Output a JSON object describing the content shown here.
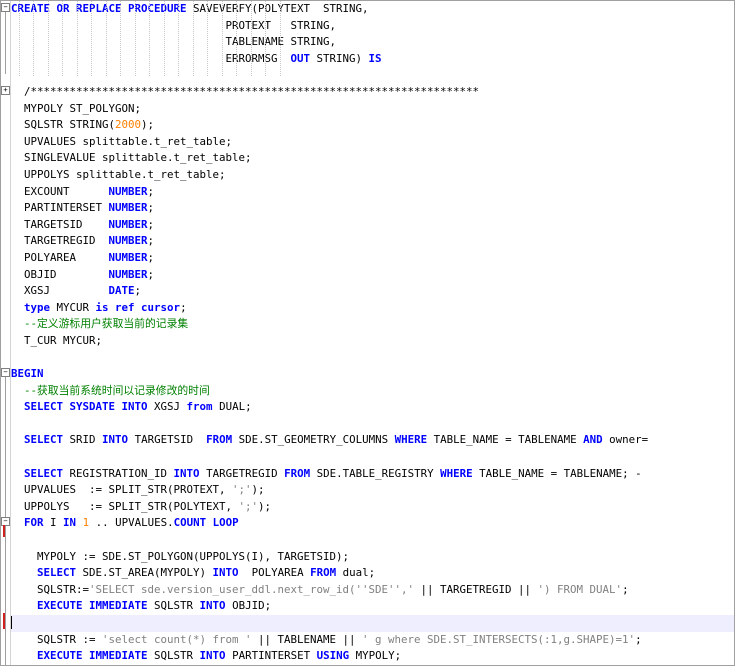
{
  "editor": {
    "language": "PL/SQL",
    "lines": [
      [
        [
          "CREATE OR REPLACE PROCEDURE",
          "kwb"
        ],
        [
          " SAVEVERFY(POLYTEXT  STRING,",
          ""
        ]
      ],
      [
        [
          "                                 PROTEXT   STRING,",
          ""
        ]
      ],
      [
        [
          "                                 TABLENAME STRING,",
          ""
        ]
      ],
      [
        [
          "                                 ERRORMSG  ",
          ""
        ],
        [
          "OUT",
          "kwb"
        ],
        [
          " STRING) ",
          ""
        ],
        [
          "IS",
          "kwb"
        ]
      ],
      [
        [
          "",
          ""
        ]
      ],
      [
        [
          "  /*********************************************************************",
          ""
        ]
      ],
      [
        [
          "  MYPOLY ST_POLYGON;",
          ""
        ]
      ],
      [
        [
          "  SQLSTR STRING(",
          ""
        ],
        [
          "2000",
          "num"
        ],
        [
          ");",
          ""
        ]
      ],
      [
        [
          "  UPVALUES splittable.t_ret_table;",
          ""
        ]
      ],
      [
        [
          "  SINGLEVALUE splittable.t_ret_table;",
          ""
        ]
      ],
      [
        [
          "  UPPOLYS splittable.t_ret_table;",
          ""
        ]
      ],
      [
        [
          "  EXCOUNT      ",
          ""
        ],
        [
          "NUMBER",
          "kwb"
        ],
        [
          ";",
          ""
        ]
      ],
      [
        [
          "  PARTINTERSET ",
          ""
        ],
        [
          "NUMBER",
          "kwb"
        ],
        [
          ";",
          ""
        ]
      ],
      [
        [
          "  TARGETSID    ",
          ""
        ],
        [
          "NUMBER",
          "kwb"
        ],
        [
          ";",
          ""
        ]
      ],
      [
        [
          "  TARGETREGID  ",
          ""
        ],
        [
          "NUMBER",
          "kwb"
        ],
        [
          ";",
          ""
        ]
      ],
      [
        [
          "  POLYAREA     ",
          ""
        ],
        [
          "NUMBER",
          "kwb"
        ],
        [
          ";",
          ""
        ]
      ],
      [
        [
          "  OBJID        ",
          ""
        ],
        [
          "NUMBER",
          "kwb"
        ],
        [
          ";",
          ""
        ]
      ],
      [
        [
          "  XGSJ         ",
          ""
        ],
        [
          "DATE",
          "kwb"
        ],
        [
          ";",
          ""
        ]
      ],
      [
        [
          "  ",
          ""
        ],
        [
          "type",
          "kwb"
        ],
        [
          " MYCUR ",
          ""
        ],
        [
          "is ref cursor",
          "kwb"
        ],
        [
          ";",
          ""
        ]
      ],
      [
        [
          "  --定义游标用户获取当前的记录集",
          "cmt"
        ]
      ],
      [
        [
          "  T_CUR MYCUR;",
          ""
        ]
      ],
      [
        [
          "",
          ""
        ]
      ],
      [
        [
          "BEGIN",
          "kwb"
        ]
      ],
      [
        [
          "  --获取当前系统时间以记录修改的时间",
          "cmt"
        ]
      ],
      [
        [
          "  ",
          ""
        ],
        [
          "SELECT SYSDATE INTO",
          "kwb"
        ],
        [
          " XGSJ ",
          ""
        ],
        [
          "from",
          "kwb"
        ],
        [
          " DUAL;",
          ""
        ]
      ],
      [
        [
          "",
          ""
        ]
      ],
      [
        [
          "  ",
          ""
        ],
        [
          "SELECT",
          "kwb"
        ],
        [
          " SRID ",
          ""
        ],
        [
          "INTO",
          "kwb"
        ],
        [
          " TARGETSID  ",
          ""
        ],
        [
          "FROM",
          "kwb"
        ],
        [
          " SDE.ST_GEOMETRY_COLUMNS ",
          ""
        ],
        [
          "WHERE",
          "kwb"
        ],
        [
          " TABLE_NAME = TABLENAME ",
          ""
        ],
        [
          "AND",
          "kwb"
        ],
        [
          " owner=",
          ""
        ]
      ],
      [
        [
          "",
          ""
        ]
      ],
      [
        [
          "  ",
          ""
        ],
        [
          "SELECT",
          "kwb"
        ],
        [
          " REGISTRATION_ID ",
          ""
        ],
        [
          "INTO",
          "kwb"
        ],
        [
          " TARGETREGID ",
          ""
        ],
        [
          "FROM",
          "kwb"
        ],
        [
          " SDE.TABLE_REGISTRY ",
          ""
        ],
        [
          "WHERE",
          "kwb"
        ],
        [
          " TABLE_NAME = TABLENAME; -",
          ""
        ]
      ],
      [
        [
          "  UPVALUES  := SPLIT_STR(PROTEXT, ",
          ""
        ],
        [
          "';'",
          "str"
        ],
        [
          ");",
          ""
        ]
      ],
      [
        [
          "  UPPOLYS   := SPLIT_STR(POLYTEXT, ",
          ""
        ],
        [
          "';'",
          "str"
        ],
        [
          ");",
          ""
        ]
      ],
      [
        [
          "  ",
          ""
        ],
        [
          "FOR",
          "kwb"
        ],
        [
          " I ",
          ""
        ],
        [
          "IN",
          "kwb"
        ],
        [
          " ",
          ""
        ],
        [
          "1",
          "num"
        ],
        [
          " .. UPVALUES.",
          ""
        ],
        [
          "COUNT LOOP",
          "kwb"
        ]
      ],
      [
        [
          "",
          ""
        ]
      ],
      [
        [
          "    MYPOLY := SDE.ST_POLYGON(UPPOLYS(I), TARGETSID);",
          ""
        ]
      ],
      [
        [
          "    ",
          ""
        ],
        [
          "SELECT",
          "kwb"
        ],
        [
          " SDE.ST_AREA(MYPOLY) ",
          ""
        ],
        [
          "INTO",
          "kwb"
        ],
        [
          "  POLYAREA ",
          ""
        ],
        [
          "FROM",
          "kwb"
        ],
        [
          " dual;",
          ""
        ]
      ],
      [
        [
          "    SQLSTR:=",
          ""
        ],
        [
          "'SELECT sde.version_user_ddl.next_row_id(''SDE'','",
          "str"
        ],
        [
          " || TARGETREGID || ",
          ""
        ],
        [
          "') FROM DUAL'",
          "str"
        ],
        [
          ";",
          ""
        ]
      ],
      [
        [
          "    ",
          ""
        ],
        [
          "EXECUTE IMMEDIATE",
          "kwb"
        ],
        [
          " SQLSTR ",
          ""
        ],
        [
          "INTO",
          "kwb"
        ],
        [
          " OBJID;",
          ""
        ]
      ],
      [
        [
          "",
          ""
        ]
      ],
      [
        [
          "    SQLSTR := ",
          ""
        ],
        [
          "'select count(*) from '",
          "str"
        ],
        [
          " || TABLENAME || ",
          ""
        ],
        [
          "' g where SDE.ST_INTERSECTS(:1,g.SHAPE)=1'",
          "str"
        ],
        [
          ";",
          ""
        ]
      ],
      [
        [
          "    ",
          ""
        ],
        [
          "EXECUTE IMMEDIATE",
          "kwb"
        ],
        [
          " SQLSTR ",
          ""
        ],
        [
          "INTO",
          "kwb"
        ],
        [
          " PARTINTERSET ",
          ""
        ],
        [
          "USING",
          "kwb"
        ],
        [
          " MYPOLY;",
          ""
        ]
      ]
    ],
    "current_line": 37
  }
}
